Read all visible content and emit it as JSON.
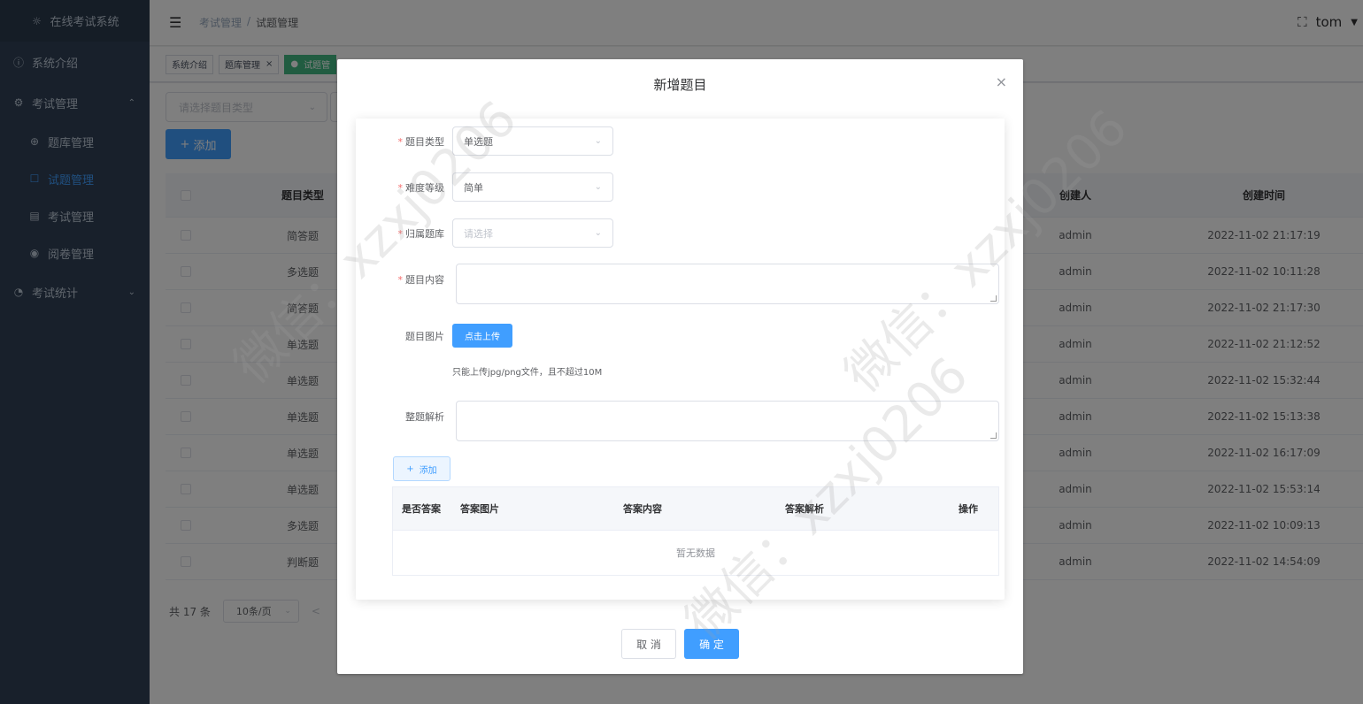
{
  "sidebar": {
    "logo_text": "在线考试系统",
    "items": [
      {
        "label": "系统介绍"
      },
      {
        "label": "考试管理"
      },
      {
        "label": "题库管理"
      },
      {
        "label": "试题管理"
      },
      {
        "label": "考试管理"
      },
      {
        "label": "阅卷管理"
      },
      {
        "label": "考试统计"
      }
    ]
  },
  "header": {
    "breadcrumb": [
      "考试管理",
      "/",
      "试题管理"
    ],
    "user": "tom"
  },
  "tags": [
    {
      "label": "系统介绍"
    },
    {
      "label": "题库管理",
      "close": "×"
    },
    {
      "label": "试题管"
    }
  ],
  "filter": {
    "placeholder": "请选择题目类型",
    "add_label": "添加"
  },
  "table": {
    "headers": {
      "type": "题目类型",
      "creator": "创建人",
      "time": "创建时间"
    },
    "rows": [
      {
        "type": "简答题",
        "creator": "admin",
        "time": "2022-11-02 21:17:19"
      },
      {
        "type": "多选题",
        "creator": "admin",
        "time": "2022-11-02 10:11:28"
      },
      {
        "type": "简答题",
        "creator": "admin",
        "time": "2022-11-02 21:17:30"
      },
      {
        "type": "单选题",
        "creator": "admin",
        "time": "2022-11-02 21:12:52"
      },
      {
        "type": "单选题",
        "creator": "admin",
        "time": "2022-11-02 15:32:44"
      },
      {
        "type": "单选题",
        "creator": "admin",
        "time": "2022-11-02 15:13:38"
      },
      {
        "type": "单选题",
        "creator": "admin",
        "time": "2022-11-02 16:17:09"
      },
      {
        "type": "单选题",
        "creator": "admin",
        "time": "2022-11-02 15:53:14"
      },
      {
        "type": "多选题",
        "creator": "admin",
        "time": "2022-11-02 10:09:13"
      },
      {
        "type": "判断题",
        "creator": "admin",
        "time": "2022-11-02 14:54:09"
      }
    ]
  },
  "pager": {
    "total": "共 17 条",
    "page_size": "10条/页",
    "prev": "<"
  },
  "dialog": {
    "title": "新增题目",
    "close": "×",
    "form": {
      "type_label": "题目类型",
      "type_value": "单选题",
      "level_label": "难度等级",
      "level_value": "简单",
      "bank_label": "归属题库",
      "bank_placeholder": "请选择",
      "content_label": "题目内容",
      "image_label": "题目图片",
      "upload_label": "点击上传",
      "upload_tip": "只能上传jpg/png文件，且不超过10M",
      "analysis_label": "整题解析",
      "add_label": "添加"
    },
    "answer_table": {
      "headers": [
        "是否答案",
        "答案图片",
        "答案内容",
        "答案解析",
        "操作"
      ],
      "empty": "暂无数据"
    },
    "cancel": "取 消",
    "confirm": "确 定"
  },
  "watermark": "微信：xzxj0206"
}
